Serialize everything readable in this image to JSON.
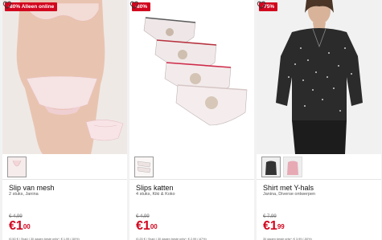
{
  "products": [
    {
      "badge": "-80% Alleen online",
      "title": "Slip van mesh",
      "subtitle": "2 stuks, Janina",
      "old_price": "€ 4,99",
      "price_currency": "€",
      "price_whole": "1",
      "price_cents": "00",
      "unit_note": "(0,50 € / Stuk)  |  30 dagen beste prijs*: € 1,99 (-50%)"
    },
    {
      "badge": "-80%",
      "title": "Slips katten",
      "subtitle": "4 stuks, Kiki & Koko",
      "old_price": "€ 4,99",
      "price_currency": "€",
      "price_whole": "1",
      "price_cents": "00",
      "unit_note": "(0,25 € / Stuk)  |  30 dagen beste prijs*: € 2,99 (-67%)"
    },
    {
      "badge": "-75%",
      "title": "Shirt met Y-hals",
      "subtitle": "Janina, Diverse ontwerpen",
      "old_price": "€ 7,99",
      "price_currency": "€",
      "price_whole": "1",
      "price_cents": "99",
      "unit_note": "30 dagen beste prijs*: € 3,99 (-50%)"
    }
  ],
  "colors": {
    "badge_bg": "#d2051e",
    "price": "#d2051e"
  },
  "icons": {
    "wishlist": "heart-outline-icon"
  }
}
